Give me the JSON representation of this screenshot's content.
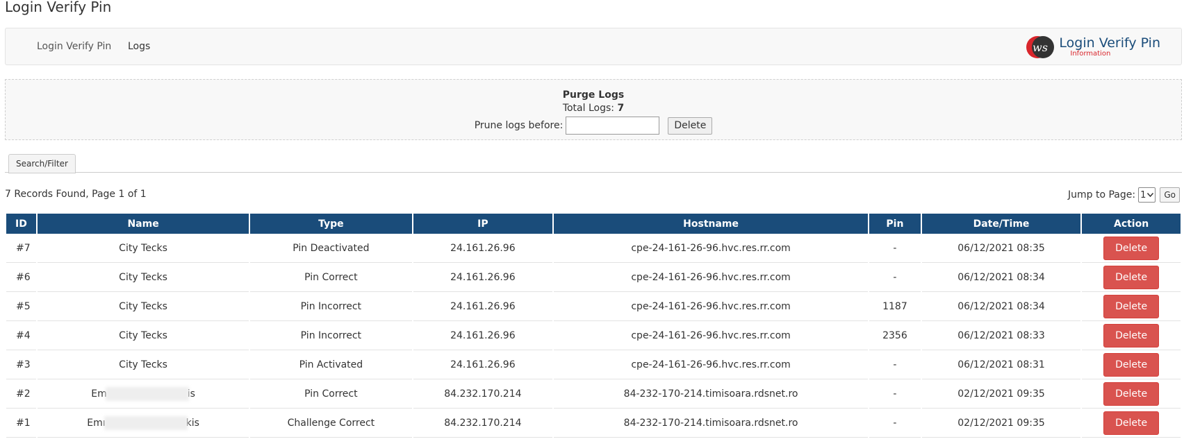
{
  "page": {
    "title": "Login Verify Pin"
  },
  "nav": {
    "items": [
      {
        "label": "Login Verify Pin"
      },
      {
        "label": "Logs"
      }
    ],
    "brand": {
      "title": "Login Verify Pin",
      "subtitle": "Information",
      "logo_text": "ws"
    }
  },
  "purge": {
    "title": "Purge Logs",
    "total_label": "Total Logs:",
    "total_value": "7",
    "prune_label": "Prune logs before:",
    "prune_value": "",
    "delete_label": "Delete"
  },
  "tabs": [
    {
      "label": "Search/Filter"
    }
  ],
  "pagination": {
    "summary": "7 Records Found, Page 1 of 1",
    "jump_label": "Jump to Page:",
    "page_selected": "1",
    "go_label": "Go"
  },
  "table": {
    "headers": [
      "ID",
      "Name",
      "Type",
      "IP",
      "Hostname",
      "Pin",
      "Date/Time",
      "Action"
    ],
    "rows": [
      {
        "id": "#7",
        "name": "City Tecks",
        "type": "Pin Deactivated",
        "ip": "24.161.26.96",
        "hostname": "cpe-24-161-26-96.hvc.res.rr.com",
        "pin": "-",
        "datetime": "06/12/2021 08:35",
        "action": "Delete"
      },
      {
        "id": "#6",
        "name": "City Tecks",
        "type": "Pin Correct",
        "ip": "24.161.26.96",
        "hostname": "cpe-24-161-26-96.hvc.res.rr.com",
        "pin": "-",
        "datetime": "06/12/2021 08:34",
        "action": "Delete"
      },
      {
        "id": "#5",
        "name": "City Tecks",
        "type": "Pin Incorrect",
        "ip": "24.161.26.96",
        "hostname": "cpe-24-161-26-96.hvc.res.rr.com",
        "pin": "1187",
        "datetime": "06/12/2021 08:34",
        "action": "Delete"
      },
      {
        "id": "#4",
        "name": "City Tecks",
        "type": "Pin Incorrect",
        "ip": "24.161.26.96",
        "hostname": "cpe-24-161-26-96.hvc.res.rr.com",
        "pin": "2356",
        "datetime": "06/12/2021 08:33",
        "action": "Delete"
      },
      {
        "id": "#3",
        "name": "City Tecks",
        "type": "Pin Activated",
        "ip": "24.161.26.96",
        "hostname": "cpe-24-161-26-96.hvc.res.rr.com",
        "pin": "-",
        "datetime": "06/12/2021 08:31",
        "action": "Delete"
      },
      {
        "id": "#2",
        "name_start": "Em",
        "name_end": "is",
        "type": "Pin Correct",
        "ip": "84.232.170.214",
        "hostname": "84-232-170-214.timisoara.rdsnet.ro",
        "pin": "-",
        "datetime": "02/12/2021 09:35",
        "action": "Delete"
      },
      {
        "id": "#1",
        "name_start": "Emı",
        "name_end": "kis",
        "type": "Challenge Correct",
        "ip": "84.232.170.214",
        "hostname": "84-232-170-214.timisoara.rdsnet.ro",
        "pin": "-",
        "datetime": "02/12/2021 09:35",
        "action": "Delete"
      }
    ]
  },
  "colors": {
    "header_bg": "#1a4c7a",
    "delete_btn": "#d9534f",
    "brand_red": "#d9262c"
  }
}
